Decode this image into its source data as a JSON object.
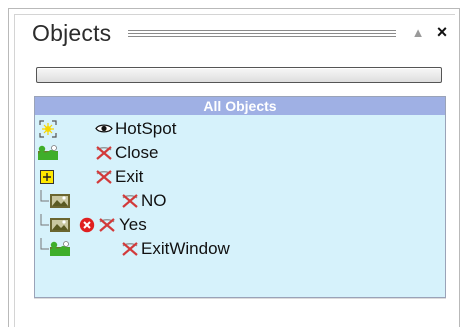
{
  "panel": {
    "title": "Objects"
  },
  "list": {
    "header": "All Objects",
    "items": [
      {
        "label": "HotSpot",
        "icon": "hotspot-icon",
        "visibility": "eye-icon"
      },
      {
        "label": "Close",
        "icon": "scene-object-icon",
        "visibility": "hidden-x-icon"
      },
      {
        "label": "Exit",
        "icon": "expand-plus-icon",
        "visibility": "hidden-x-icon"
      },
      {
        "label": "NO",
        "icon": "scene-object-icon",
        "visibility": "hidden-x-icon"
      },
      {
        "label": "Yes",
        "icon": "scene-object-icon",
        "visibility": "hidden-x-icon",
        "status": "error-icon"
      },
      {
        "label": "ExitWindow",
        "icon": "scene-object-icon",
        "visibility": "hidden-x-icon"
      }
    ]
  },
  "colors": {
    "list_bg": "#d6f2fb",
    "header_bg": "#9fb0e4",
    "error_red": "#e02020",
    "hidden_x_red": "#d23a3a"
  }
}
